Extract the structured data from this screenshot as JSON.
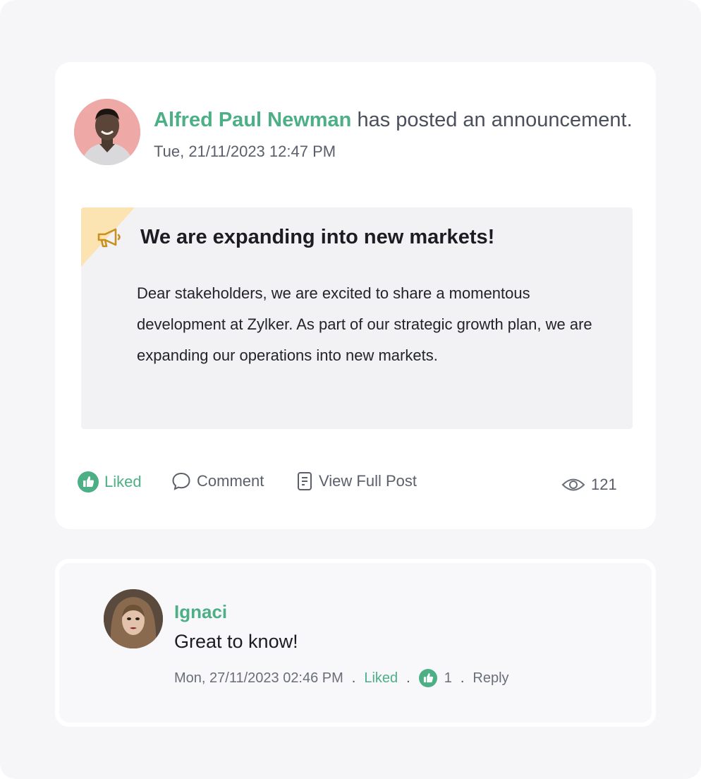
{
  "post": {
    "author_name": "Alfred Paul Newman",
    "header_suffix": "has posted an announcement.",
    "timestamp": "Tue, 21/11/2023 12:47 PM",
    "announcement": {
      "icon": "megaphone-icon",
      "title": "We are expanding into new markets!",
      "body": "Dear stakeholders, we are excited to share a momentous development at Zylker. As part of our strategic growth plan, we are expanding our operations into new markets."
    },
    "actions": {
      "liked_label": "Liked",
      "comment_label": "Comment",
      "view_full_label": "View Full Post"
    },
    "view_count": "121"
  },
  "comment": {
    "author_name": "Ignaci",
    "text": "Great to know!",
    "timestamp": "Mon, 27/11/2023 02:46 PM",
    "liked_label": "Liked",
    "like_count": "1",
    "reply_label": "Reply"
  },
  "colors": {
    "accent": "#4caf85",
    "announcement_bg": "#f2f2f4",
    "corner": "#fbe3b2",
    "megaphone": "#c9901e"
  }
}
